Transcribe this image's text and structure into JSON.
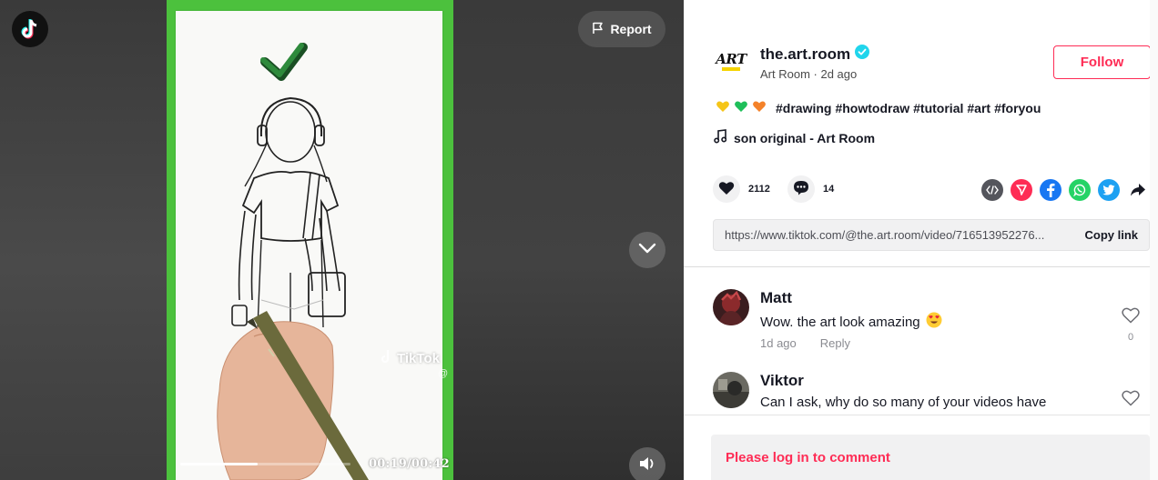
{
  "player": {
    "report_label": "Report",
    "time_display": "00:19/00:42",
    "progress_fraction": 0.4524,
    "watermark_text": "TikTok",
    "watermark_handle": "@",
    "icons": {
      "logo": "tiktok-logo-icon",
      "report": "flag-icon",
      "next": "chevron-down-icon",
      "volume": "volume-icon"
    }
  },
  "author": {
    "avatar_text": "ART",
    "username": "the.art.room",
    "verified": true,
    "display_name": "Art Room",
    "posted": "2d ago",
    "follow_label": "Follow"
  },
  "post": {
    "emojis": [
      "yellow-heart",
      "green-heart",
      "orange-heart"
    ],
    "hashtags": [
      "#drawing",
      "#howtodraw",
      "#tutorial",
      "#art",
      "#foryou"
    ],
    "music": "son original - Art Room",
    "likes": "2112",
    "comments": "14",
    "share_icons": [
      "embed-icon",
      "send-icon",
      "facebook-icon",
      "whatsapp-icon",
      "twitter-icon",
      "share-arrow-icon"
    ],
    "link": "https://www.tiktok.com/@the.art.room/video/716513952276...",
    "copy_label": "Copy link"
  },
  "comments": [
    {
      "name": "Matt",
      "text": "Wow. the art look amazing",
      "emoji": "heart-eyes",
      "time": "1d ago",
      "reply_label": "Reply",
      "likes": "0"
    },
    {
      "name": "Viktor",
      "text": "Can I ask, why do so many of your videos have",
      "time": "",
      "reply_label": "",
      "likes": ""
    }
  ],
  "login_prompt": "Please log in to comment",
  "colors": {
    "brand": "#fe2c55",
    "verified": "#20d5ec",
    "green_screen": "#4cc13d"
  }
}
